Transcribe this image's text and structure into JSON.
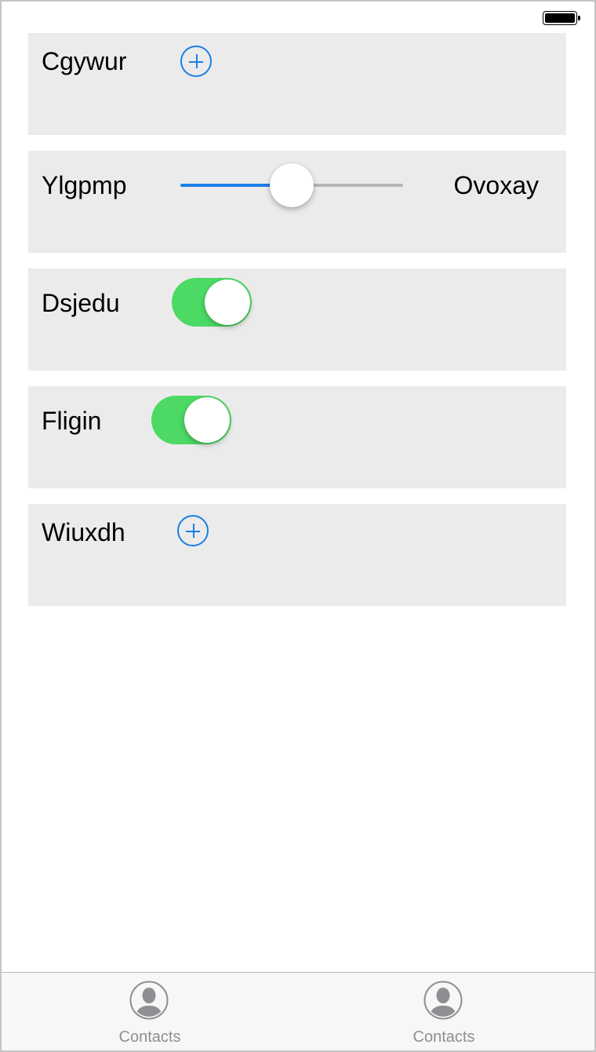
{
  "status_bar": {
    "battery_icon": "battery-icon"
  },
  "rows": [
    {
      "label": "Cgywur",
      "control": "add-button",
      "icon": "plus-circle-icon"
    },
    {
      "label": "Ylgpmp",
      "control": "slider",
      "value_fraction": 0.5,
      "right_label": "Ovoxay"
    },
    {
      "label": "Dsjedu",
      "control": "toggle",
      "on": true
    },
    {
      "label": "Fligin",
      "control": "toggle",
      "on": true
    },
    {
      "label": "Wiuxdh",
      "control": "add-button",
      "icon": "plus-circle-icon"
    }
  ],
  "tabbar": {
    "tabs": [
      {
        "label": "Contacts",
        "icon": "contact-icon"
      },
      {
        "label": "Contacts",
        "icon": "contact-icon"
      }
    ]
  },
  "colors": {
    "accent_blue": "#1a7ee6",
    "toggle_on_green": "#4cd964",
    "row_background": "#ebebeb",
    "tab_label_gray": "#8e8e93"
  }
}
